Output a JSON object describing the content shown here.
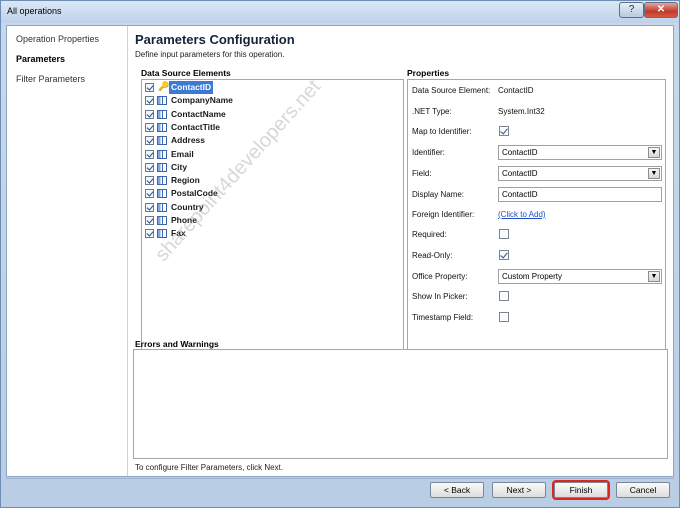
{
  "window": {
    "title": "All operations",
    "help_label": "?",
    "close_label": "✕"
  },
  "nav": {
    "items": [
      "Operation Properties",
      "Parameters",
      "Filter Parameters"
    ],
    "active": "Parameters"
  },
  "header": {
    "title": "Parameters Configuration",
    "subtitle": "Define input parameters for this operation."
  },
  "data_source": {
    "label": "Data Source Elements",
    "items": [
      {
        "label": "ContactID",
        "checked": true,
        "icon": "key-icon",
        "selected": true
      },
      {
        "label": "CompanyName",
        "checked": true,
        "icon": "column-icon"
      },
      {
        "label": "ContactName",
        "checked": true,
        "icon": "column-icon"
      },
      {
        "label": "ContactTitle",
        "checked": true,
        "icon": "column-icon"
      },
      {
        "label": "Address",
        "checked": true,
        "icon": "column-icon"
      },
      {
        "label": "Email",
        "checked": true,
        "icon": "column-icon"
      },
      {
        "label": "City",
        "checked": true,
        "icon": "column-icon"
      },
      {
        "label": "Region",
        "checked": true,
        "icon": "column-icon"
      },
      {
        "label": "PostalCode",
        "checked": true,
        "icon": "column-icon"
      },
      {
        "label": "Country",
        "checked": true,
        "icon": "column-icon"
      },
      {
        "label": "Phone",
        "checked": true,
        "icon": "column-icon"
      },
      {
        "label": "Fax",
        "checked": true,
        "icon": "column-icon"
      }
    ]
  },
  "properties": {
    "label": "Properties",
    "data_source_element": {
      "label": "Data Source Element:",
      "value": "ContactID"
    },
    "net_type": {
      "label": ".NET Type:",
      "value": "System.Int32"
    },
    "map_to_identifier": {
      "label": "Map to Identifier:",
      "checked": true
    },
    "identifier": {
      "label": "Identifier:",
      "value": "ContactID"
    },
    "field": {
      "label": "Field:",
      "value": "ContactID"
    },
    "display_name": {
      "label": "Display Name:",
      "value": "ContactID"
    },
    "foreign_identifier": {
      "label": "Foreign Identifier:",
      "link": "(Click to Add)"
    },
    "required": {
      "label": "Required:",
      "checked": false
    },
    "read_only": {
      "label": "Read-Only:",
      "checked": true
    },
    "office_property": {
      "label": "Office Property:",
      "value": "Custom Property"
    },
    "show_in_picker": {
      "label": "Show In Picker:",
      "checked": false
    },
    "timestamp_field": {
      "label": "Timestamp Field:",
      "checked": false
    }
  },
  "errors": {
    "label": "Errors and Warnings"
  },
  "hint": "To configure Filter Parameters, click Next.",
  "buttons": {
    "back": "< Back",
    "next": "Next >",
    "finish": "Finish",
    "cancel": "Cancel"
  },
  "watermark": "sharepoint4developers.net",
  "colors": {
    "selection": "#3a79d6",
    "finish_focus": "#e0241c",
    "link": "#1f4ec8"
  }
}
